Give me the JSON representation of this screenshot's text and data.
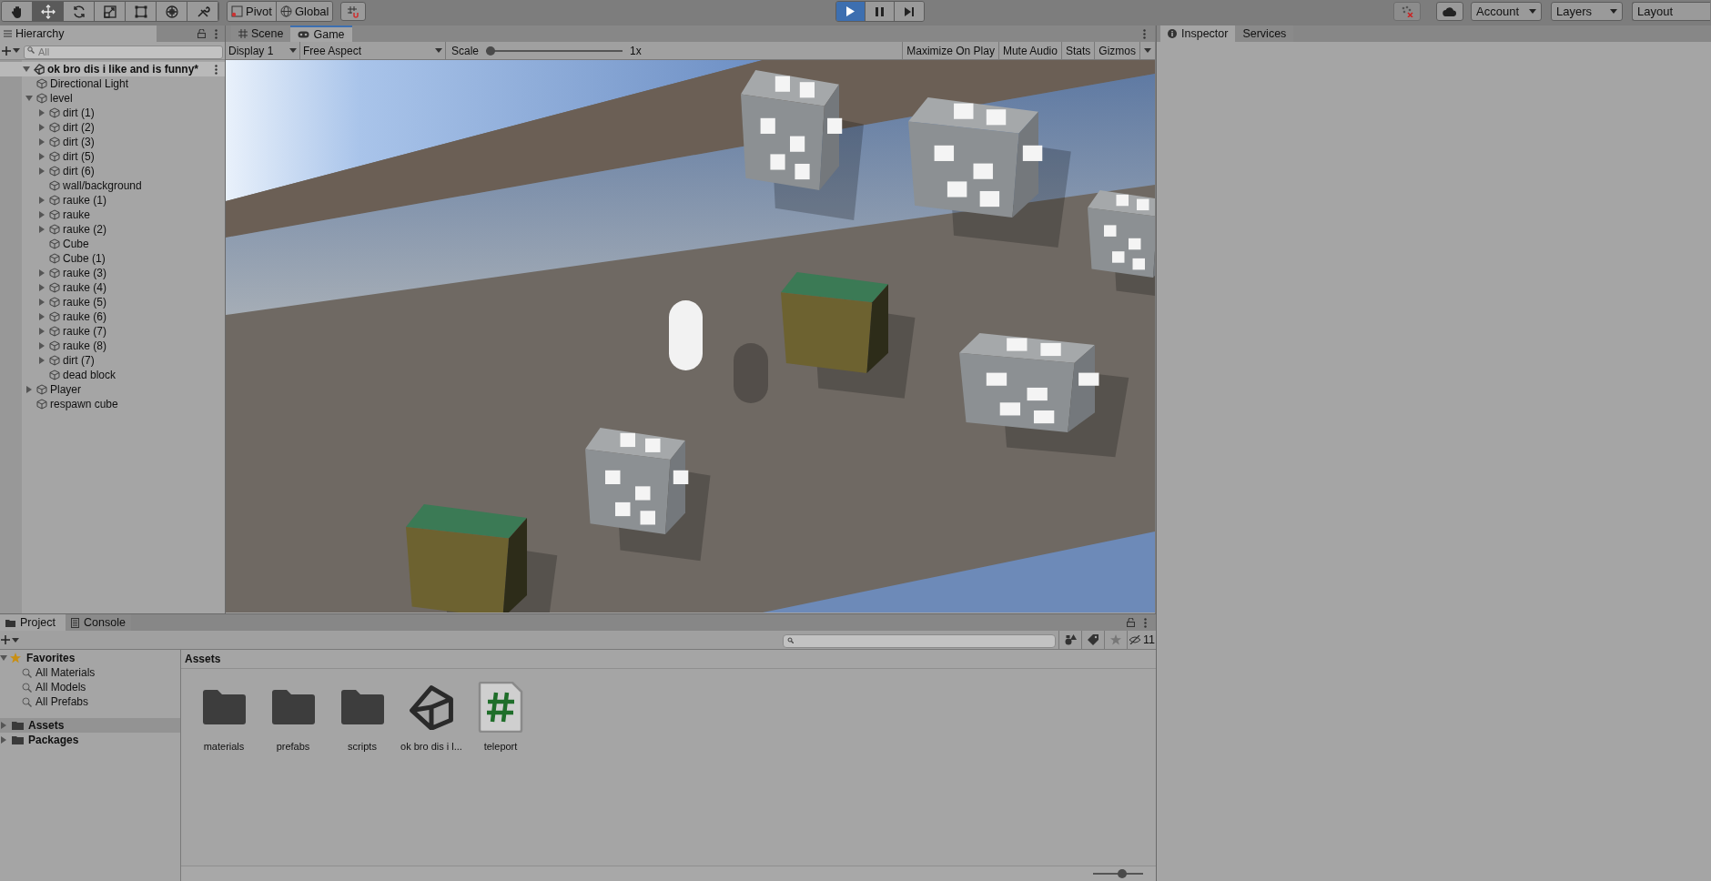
{
  "toolbar": {
    "tools": [
      {
        "kind": "hand",
        "selected": false
      },
      {
        "kind": "move",
        "selected": true
      },
      {
        "kind": "rotate",
        "selected": false
      },
      {
        "kind": "scale",
        "selected": false
      },
      {
        "kind": "rect",
        "selected": false
      },
      {
        "kind": "transform",
        "selected": false
      },
      {
        "kind": "custom",
        "selected": false
      }
    ],
    "pivot": "Pivot",
    "global": "Global",
    "playback": {
      "playing": true,
      "paused": false
    },
    "account": "Account",
    "layers": "Layers",
    "layout": "Layout"
  },
  "hierarchy": {
    "title": "Hierarchy",
    "search_placeholder": "All",
    "scene": {
      "name": "ok bro dis i like and is funny*",
      "expanded": true,
      "children": [
        {
          "name": "Directional Light"
        },
        {
          "name": "level",
          "expanded": true,
          "children": [
            {
              "name": "dirt (1)",
              "expanded": false
            },
            {
              "name": "dirt (2)",
              "expanded": false
            },
            {
              "name": "dirt (3)",
              "expanded": false
            },
            {
              "name": "dirt (5)",
              "expanded": false
            },
            {
              "name": "dirt (6)",
              "expanded": false
            },
            {
              "name": "wall/background"
            },
            {
              "name": "rauke (1)",
              "expanded": false
            },
            {
              "name": "rauke",
              "expanded": false
            },
            {
              "name": "rauke (2)",
              "expanded": false
            },
            {
              "name": "Cube"
            },
            {
              "name": "Cube (1)"
            },
            {
              "name": "rauke (3)",
              "expanded": false
            },
            {
              "name": "rauke (4)",
              "expanded": false
            },
            {
              "name": "rauke (5)",
              "expanded": false
            },
            {
              "name": "rauke (6)",
              "expanded": false
            },
            {
              "name": "rauke (7)",
              "expanded": false
            },
            {
              "name": "rauke (8)",
              "expanded": false
            },
            {
              "name": "dirt (7)",
              "expanded": false
            },
            {
              "name": "dead block"
            }
          ]
        },
        {
          "name": "Player",
          "expanded": false
        },
        {
          "name": "respawn cube"
        }
      ]
    }
  },
  "game_panel": {
    "tabs": [
      {
        "label": "Scene",
        "kind": "scene",
        "selected": false
      },
      {
        "label": "Game",
        "kind": "game",
        "selected": true
      }
    ],
    "display": "Display 1",
    "aspect": "Free Aspect",
    "scale_label": "Scale",
    "scale": {
      "level": 0
    },
    "scale_value": "1x",
    "buttons": [
      "Maximize On Play",
      "Mute Audio",
      "Stats",
      "Gizmos"
    ]
  },
  "inspector": {
    "tabs": [
      {
        "label": "Inspector",
        "kind": "inspector",
        "selected": true
      },
      {
        "label": "Services",
        "kind": "services",
        "selected": false
      }
    ]
  },
  "project": {
    "tabs": [
      {
        "label": "Project",
        "kind": "project",
        "selected": true
      },
      {
        "label": "Console",
        "kind": "console",
        "selected": false
      }
    ],
    "hidden_count": "11",
    "favorites": {
      "label": "Favorites",
      "expanded": true,
      "items": [
        "All Materials",
        "All Models",
        "All Prefabs"
      ]
    },
    "roots": [
      {
        "label": "Assets",
        "expanded": false,
        "selected": true
      },
      {
        "label": "Packages",
        "expanded": false,
        "selected": false
      }
    ],
    "breadcrumb": "Assets",
    "assets": [
      {
        "kind": "folder",
        "name": "materials"
      },
      {
        "kind": "folder",
        "name": "prefabs"
      },
      {
        "kind": "folder",
        "name": "scripts"
      },
      {
        "kind": "scene",
        "name": "ok bro dis i l..."
      },
      {
        "kind": "script",
        "name": "teleport"
      }
    ],
    "zoom": {
      "level": 0.6
    }
  }
}
